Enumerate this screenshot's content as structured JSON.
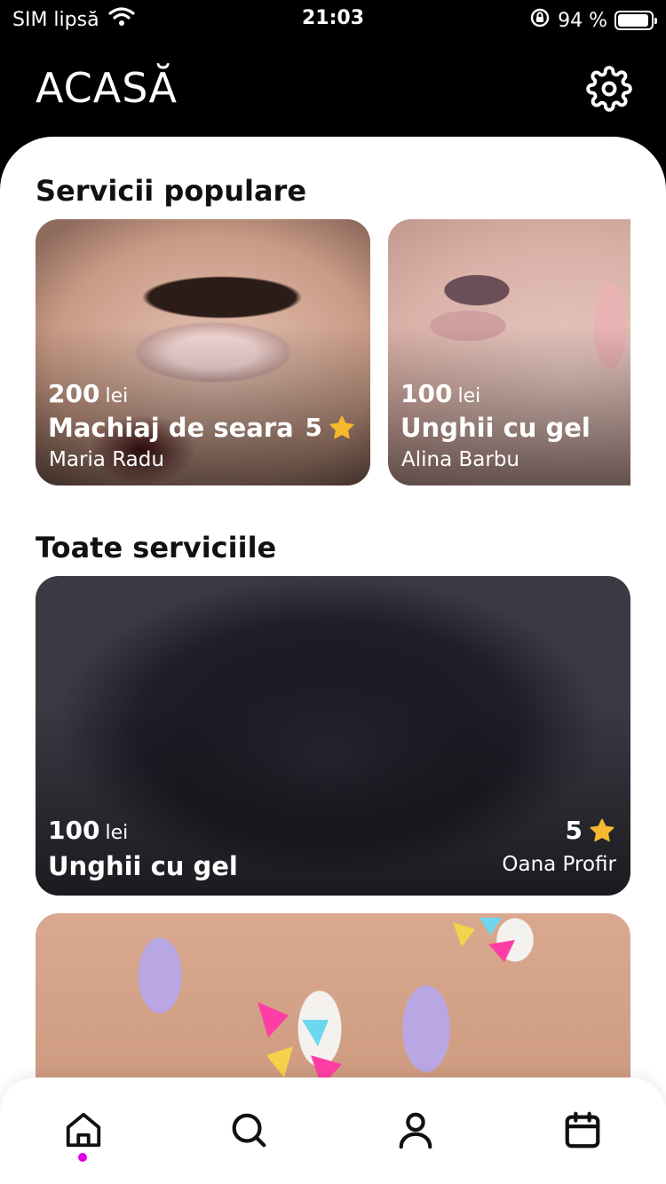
{
  "status_bar": {
    "carrier": "SIM lipsă",
    "time": "21:03",
    "battery_text": "94 %",
    "battery_level": 0.94
  },
  "header": {
    "title": "ACASĂ",
    "settings_icon": "gear-icon"
  },
  "popular": {
    "title": "Servicii populare",
    "cards": [
      {
        "price": "200",
        "unit": "lei",
        "name": "Machiaj de seara",
        "provider": "Maria Radu",
        "rating": "5"
      },
      {
        "price": "100",
        "unit": "lei",
        "name": "Unghii cu gel",
        "provider": "Alina Barbu"
      }
    ]
  },
  "all": {
    "title": "Toate serviciile",
    "cards": [
      {
        "price": "100",
        "unit": "lei",
        "name": "Unghii cu gel",
        "provider": "Oana Profir",
        "rating": "5"
      }
    ]
  },
  "tabbar": {
    "items": [
      "home-icon",
      "search-icon",
      "profile-icon",
      "calendar-icon"
    ],
    "active_color": "#e100e1"
  },
  "colors": {
    "header_bg": "#000000",
    "sheet_bg": "#ffffff",
    "star": "#f5b82e"
  }
}
